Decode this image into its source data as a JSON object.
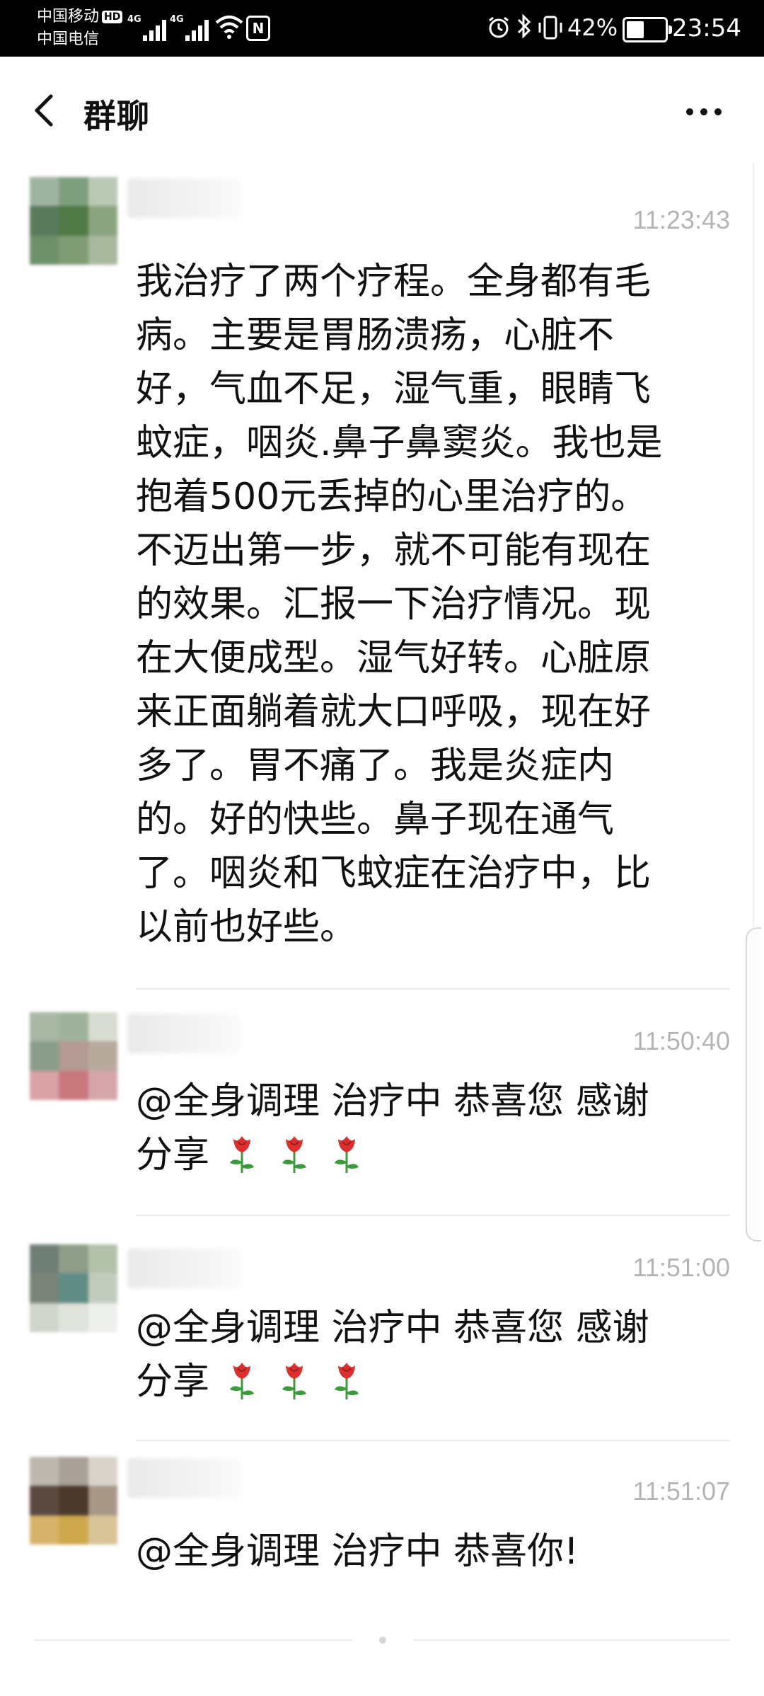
{
  "status_bar": {
    "carrier1": "中国移动",
    "hd_badge": "HD",
    "carrier2": "中国电信",
    "signal1_tag": "4G",
    "signal2_tag": "4G",
    "battery_percent": "42%",
    "battery_level": 0.42,
    "time": "23:54",
    "icons": [
      "signal-icon",
      "wifi-icon",
      "nfc-icon",
      "alarm-icon",
      "bluetooth-icon",
      "vibrate-icon",
      "battery-icon"
    ]
  },
  "header": {
    "title": "群聊",
    "back_icon": "chevron-left-icon",
    "more_icon": "more-dots-icon"
  },
  "messages": [
    {
      "time": "11:23:43",
      "lines": [
        "我治疗了两个疗程。全身都有毛",
        "病。主要是胃肠溃疡，心脏不",
        "好，气血不足，湿气重，眼睛飞",
        "蚊症，咽炎.鼻子鼻窦炎。我也是",
        "抱着500元丢掉的心里治疗的。",
        "不迈出第一步，就不可能有现在",
        "的效果。汇报一下治疗情况。现",
        "在大便成型。湿气好转。心脏原",
        "来正面躺着就大口呼吸，现在好",
        "多了。胃不痛了。我是炎症内",
        "的。好的快些。鼻子现在通气",
        "了。咽炎和飞蚊症在治疗中，比",
        "以前也好些。"
      ]
    },
    {
      "time": "11:50:40",
      "line1": "@全身调理 治疗中 恭喜您 感谢",
      "line2": "分享",
      "emoji": "rose-icon"
    },
    {
      "time": "11:51:00",
      "line1": "@全身调理 治疗中 恭喜您 感谢",
      "line2": "分享",
      "emoji": "rose-icon"
    },
    {
      "time": "11:51:07",
      "line1": "@全身调理 治疗中 恭喜你!"
    }
  ],
  "colors": {
    "status_bar_bg": "#000000",
    "page_bg": "#ffffff",
    "timestamp": "#b4b4b4",
    "divider": "#ececec",
    "rose_petal": "#d8302e",
    "rose_stem": "#3d9a3a"
  }
}
